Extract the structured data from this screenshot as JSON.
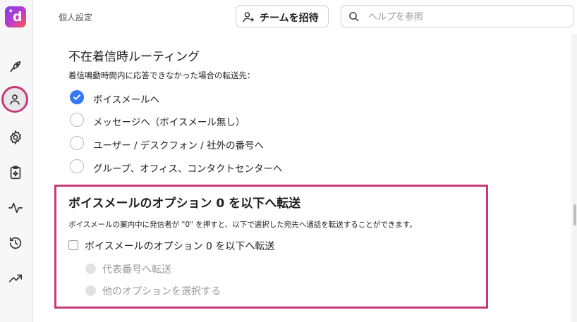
{
  "header": {
    "title": "個人設定",
    "invite_label": "チームを招待",
    "search_placeholder": "ヘルプを参照"
  },
  "sidebar": {
    "logo_letter": "d",
    "items": [
      {
        "icon": "rocket-icon"
      },
      {
        "icon": "user-icon",
        "active": true
      },
      {
        "icon": "gear-icon"
      },
      {
        "icon": "clipboard-sparkle-icon"
      },
      {
        "icon": "activity-icon"
      },
      {
        "icon": "history-icon"
      },
      {
        "icon": "trending-up-icon"
      }
    ]
  },
  "unanswered_routing": {
    "title": "不在着信時ルーティング",
    "description": "着信鳴動時間内に応答できなかった場合の転送先：",
    "options": [
      {
        "label": "ボイスメールへ",
        "selected": true
      },
      {
        "label": "メッセージへ（ボイスメール無し）",
        "selected": false
      },
      {
        "label": "ユーザー / デスクフォン / 社外の番号へ",
        "selected": false
      },
      {
        "label": "グループ、オフィス、コンタクトセンターへ",
        "selected": false
      }
    ]
  },
  "voicemail_option0": {
    "title": "ボイスメールのオプション 0 を以下へ転送",
    "description": "ボイスメールの案内中に発信者が \"0\" を押すと、以下で選択した宛先へ通話を転送することができます。",
    "checkbox_label": "ボイスメールのオプション 0 を以下へ転送",
    "checked": false,
    "sub_options": [
      {
        "label": "代表番号へ転送",
        "disabled": true
      },
      {
        "label": "他のオプションを選択する",
        "disabled": true
      }
    ]
  },
  "colors": {
    "accent": "#3478f6",
    "highlight": "#c63a7b"
  }
}
